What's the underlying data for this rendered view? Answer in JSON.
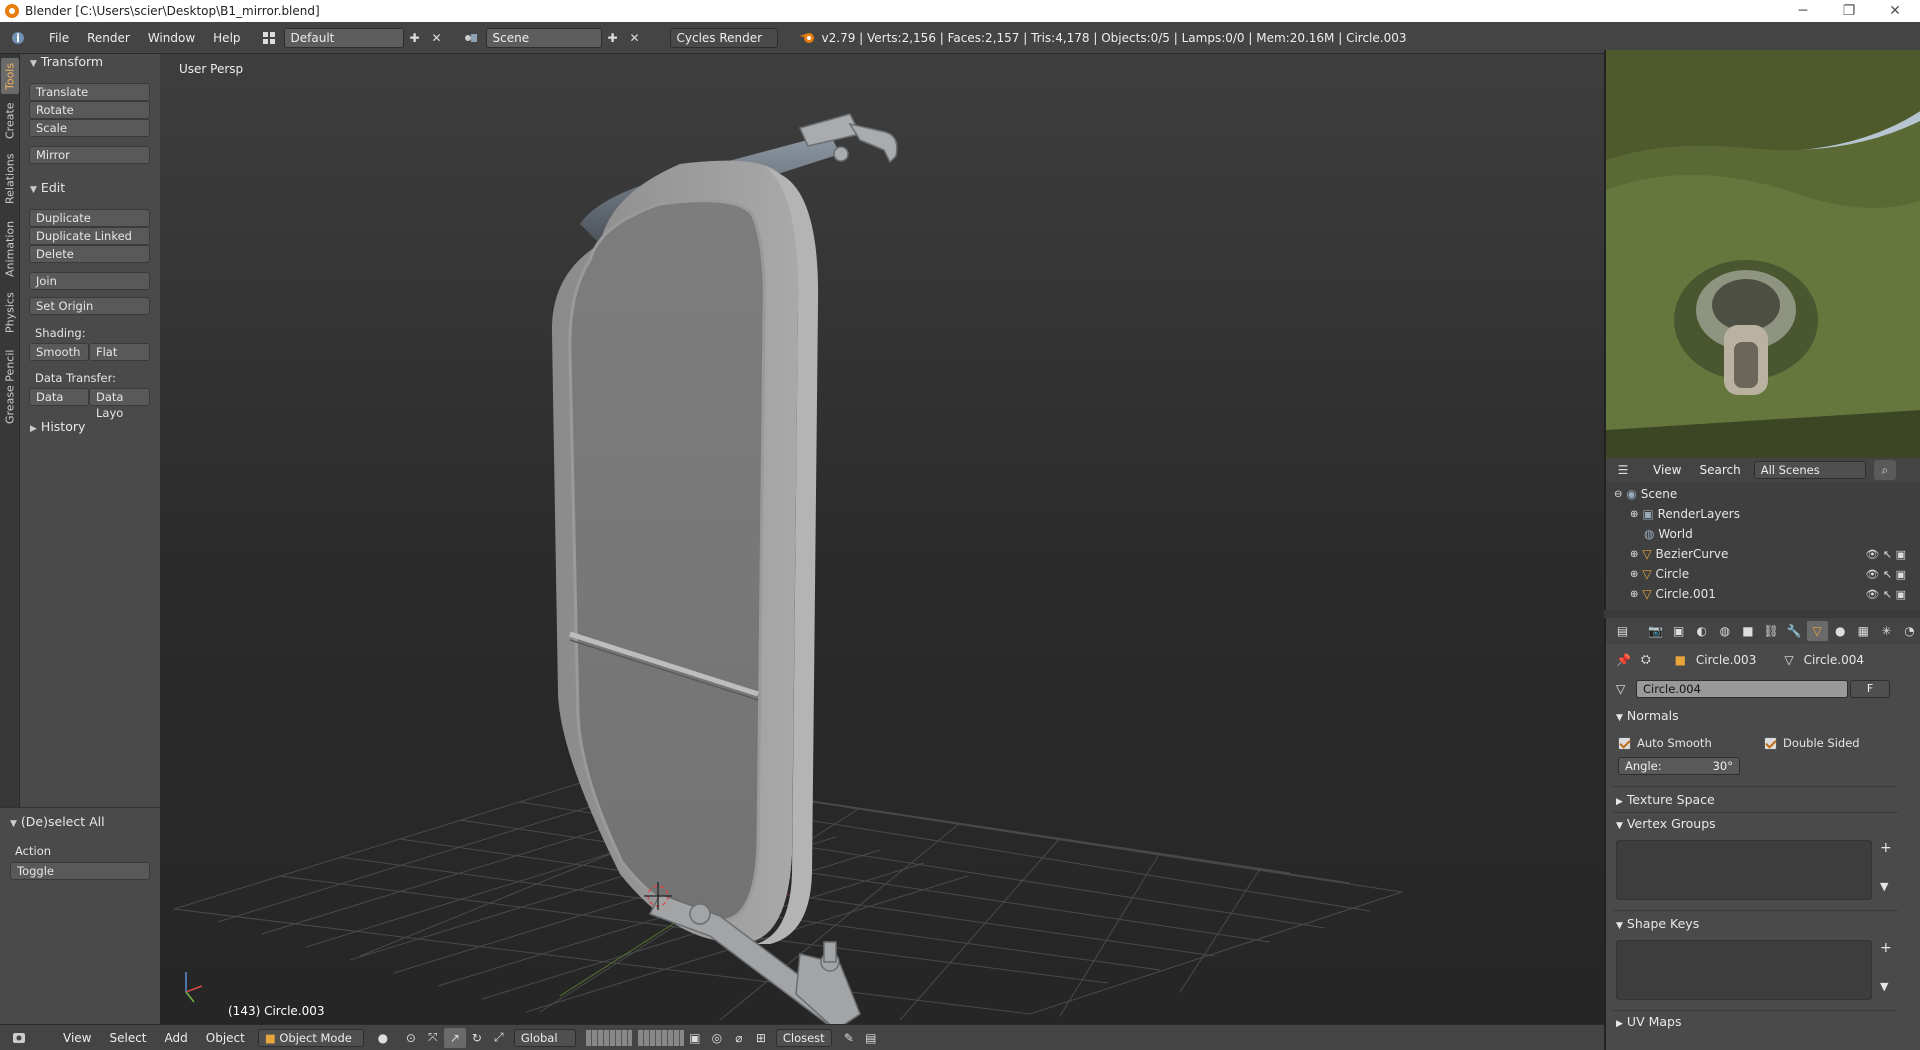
{
  "window": {
    "title": "Blender [C:\\Users\\scier\\Desktop\\B1_mirror.blend]",
    "minimize": "─",
    "restore": "❐",
    "close": "✕"
  },
  "topbar": {
    "menus": [
      "File",
      "Render",
      "Window",
      "Help"
    ],
    "layout": "Default",
    "scene": "Scene",
    "engine": "Cycles Render",
    "stats": "v2.79 | Verts:2,156 | Faces:2,157 | Tris:4,178 | Objects:0/5 | Lamps:0/0 | Mem:20.16M | Circle.003"
  },
  "tabs": [
    "Tools",
    "Create",
    "Relations",
    "Animation",
    "Physics",
    "Grease Pencil"
  ],
  "toolshelf": {
    "transform_header": "Transform",
    "translate": "Translate",
    "rotate": "Rotate",
    "scale": "Scale",
    "mirror": "Mirror",
    "edit_header": "Edit",
    "duplicate": "Duplicate",
    "duplicate_linked": "Duplicate Linked",
    "delete": "Delete",
    "join": "Join",
    "set_origin": "Set Origin",
    "shading_label": "Shading:",
    "smooth": "Smooth",
    "flat": "Flat",
    "data_transfer_label": "Data Transfer:",
    "data": "Data",
    "data_layo": "Data Layo",
    "history_header": "History"
  },
  "operator": {
    "header": "(De)select All",
    "action_label": "Action",
    "action_value": "Toggle"
  },
  "viewport": {
    "view_name": "User Persp",
    "object_info": "(143) Circle.003"
  },
  "bottombar": {
    "menus": [
      "View",
      "Select",
      "Add",
      "Object"
    ],
    "mode": "Object Mode",
    "orientation": "Global",
    "snap": "Closest"
  },
  "outliner": {
    "menus": [
      "View",
      "Search"
    ],
    "filter": "All Scenes",
    "rows": [
      "Scene",
      "RenderLayers",
      "World",
      "BezierCurve",
      "Circle",
      "Circle.001"
    ]
  },
  "properties": {
    "object_crumb": "Circle.003",
    "mesh_crumb": "Circle.004",
    "mesh_name": "Circle.004",
    "fake_user": "F",
    "normals_header": "Normals",
    "auto_smooth": "Auto Smooth",
    "double_sided": "Double Sided",
    "angle_label": "Angle:",
    "angle_value": "30°",
    "texture_space_header": "Texture Space",
    "vertex_groups_header": "Vertex Groups",
    "shape_keys_header": "Shape Keys",
    "uv_maps_header": "UV Maps"
  },
  "colors": {
    "accent": "#e87d0d",
    "panel": "#4a4a4a",
    "header": "#444444",
    "viewport_top": "#3e3e3e",
    "viewport_bottom": "#262626"
  }
}
